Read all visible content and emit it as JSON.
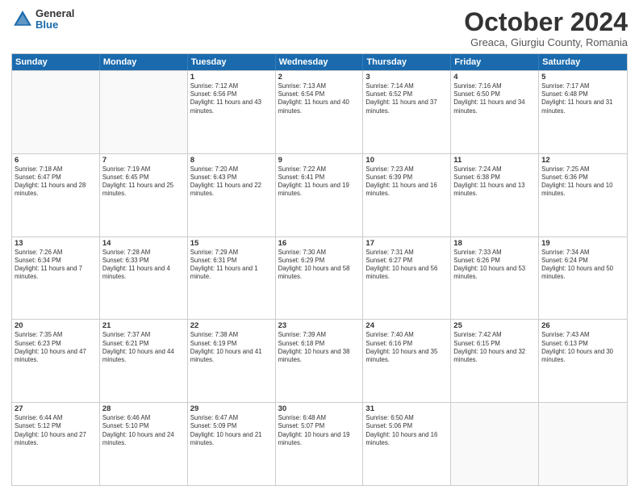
{
  "header": {
    "logo_general": "General",
    "logo_blue": "Blue",
    "month_title": "October 2024",
    "subtitle": "Greaca, Giurgiu County, Romania"
  },
  "calendar": {
    "days": [
      "Sunday",
      "Monday",
      "Tuesday",
      "Wednesday",
      "Thursday",
      "Friday",
      "Saturday"
    ],
    "rows": [
      [
        {
          "day": "",
          "empty": true
        },
        {
          "day": "",
          "empty": true
        },
        {
          "day": "1",
          "sunrise": "7:12 AM",
          "sunset": "6:56 PM",
          "daylight": "11 hours and 43 minutes."
        },
        {
          "day": "2",
          "sunrise": "7:13 AM",
          "sunset": "6:54 PM",
          "daylight": "11 hours and 40 minutes."
        },
        {
          "day": "3",
          "sunrise": "7:14 AM",
          "sunset": "6:52 PM",
          "daylight": "11 hours and 37 minutes."
        },
        {
          "day": "4",
          "sunrise": "7:16 AM",
          "sunset": "6:50 PM",
          "daylight": "11 hours and 34 minutes."
        },
        {
          "day": "5",
          "sunrise": "7:17 AM",
          "sunset": "6:48 PM",
          "daylight": "11 hours and 31 minutes."
        }
      ],
      [
        {
          "day": "6",
          "sunrise": "7:18 AM",
          "sunset": "6:47 PM",
          "daylight": "11 hours and 28 minutes."
        },
        {
          "day": "7",
          "sunrise": "7:19 AM",
          "sunset": "6:45 PM",
          "daylight": "11 hours and 25 minutes."
        },
        {
          "day": "8",
          "sunrise": "7:20 AM",
          "sunset": "6:43 PM",
          "daylight": "11 hours and 22 minutes."
        },
        {
          "day": "9",
          "sunrise": "7:22 AM",
          "sunset": "6:41 PM",
          "daylight": "11 hours and 19 minutes."
        },
        {
          "day": "10",
          "sunrise": "7:23 AM",
          "sunset": "6:39 PM",
          "daylight": "11 hours and 16 minutes."
        },
        {
          "day": "11",
          "sunrise": "7:24 AM",
          "sunset": "6:38 PM",
          "daylight": "11 hours and 13 minutes."
        },
        {
          "day": "12",
          "sunrise": "7:25 AM",
          "sunset": "6:36 PM",
          "daylight": "11 hours and 10 minutes."
        }
      ],
      [
        {
          "day": "13",
          "sunrise": "7:26 AM",
          "sunset": "6:34 PM",
          "daylight": "11 hours and 7 minutes."
        },
        {
          "day": "14",
          "sunrise": "7:28 AM",
          "sunset": "6:33 PM",
          "daylight": "11 hours and 4 minutes."
        },
        {
          "day": "15",
          "sunrise": "7:29 AM",
          "sunset": "6:31 PM",
          "daylight": "11 hours and 1 minute."
        },
        {
          "day": "16",
          "sunrise": "7:30 AM",
          "sunset": "6:29 PM",
          "daylight": "10 hours and 58 minutes."
        },
        {
          "day": "17",
          "sunrise": "7:31 AM",
          "sunset": "6:27 PM",
          "daylight": "10 hours and 56 minutes."
        },
        {
          "day": "18",
          "sunrise": "7:33 AM",
          "sunset": "6:26 PM",
          "daylight": "10 hours and 53 minutes."
        },
        {
          "day": "19",
          "sunrise": "7:34 AM",
          "sunset": "6:24 PM",
          "daylight": "10 hours and 50 minutes."
        }
      ],
      [
        {
          "day": "20",
          "sunrise": "7:35 AM",
          "sunset": "6:23 PM",
          "daylight": "10 hours and 47 minutes."
        },
        {
          "day": "21",
          "sunrise": "7:37 AM",
          "sunset": "6:21 PM",
          "daylight": "10 hours and 44 minutes."
        },
        {
          "day": "22",
          "sunrise": "7:38 AM",
          "sunset": "6:19 PM",
          "daylight": "10 hours and 41 minutes."
        },
        {
          "day": "23",
          "sunrise": "7:39 AM",
          "sunset": "6:18 PM",
          "daylight": "10 hours and 38 minutes."
        },
        {
          "day": "24",
          "sunrise": "7:40 AM",
          "sunset": "6:16 PM",
          "daylight": "10 hours and 35 minutes."
        },
        {
          "day": "25",
          "sunrise": "7:42 AM",
          "sunset": "6:15 PM",
          "daylight": "10 hours and 32 minutes."
        },
        {
          "day": "26",
          "sunrise": "7:43 AM",
          "sunset": "6:13 PM",
          "daylight": "10 hours and 30 minutes."
        }
      ],
      [
        {
          "day": "27",
          "sunrise": "6:44 AM",
          "sunset": "5:12 PM",
          "daylight": "10 hours and 27 minutes."
        },
        {
          "day": "28",
          "sunrise": "6:46 AM",
          "sunset": "5:10 PM",
          "daylight": "10 hours and 24 minutes."
        },
        {
          "day": "29",
          "sunrise": "6:47 AM",
          "sunset": "5:09 PM",
          "daylight": "10 hours and 21 minutes."
        },
        {
          "day": "30",
          "sunrise": "6:48 AM",
          "sunset": "5:07 PM",
          "daylight": "10 hours and 19 minutes."
        },
        {
          "day": "31",
          "sunrise": "6:50 AM",
          "sunset": "5:06 PM",
          "daylight": "10 hours and 16 minutes."
        },
        {
          "day": "",
          "empty": true
        },
        {
          "day": "",
          "empty": true
        }
      ]
    ]
  }
}
